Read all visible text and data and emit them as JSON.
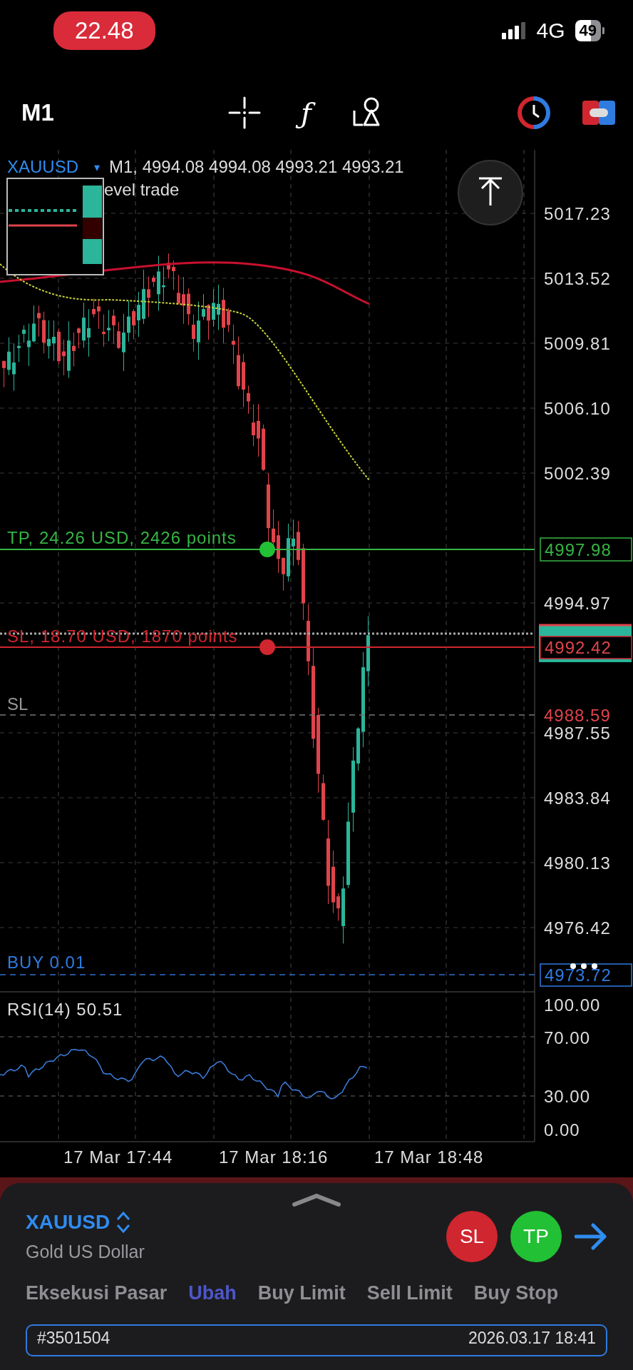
{
  "status_bar": {
    "time": "22.48",
    "network": "4G",
    "battery": "49"
  },
  "toolbar": {
    "timeframe": "M1",
    "function_symbol": "ƒ"
  },
  "chart": {
    "symbol": "XAUUSD",
    "symbol_caret": "▾",
    "quote": "M1, 4994.08 4994.08 4993.21 4993.21",
    "overlay_note": "evel trade",
    "price_axis": [
      "5017.23",
      "5013.52",
      "5009.81",
      "5006.10",
      "5002.39",
      "4994.97",
      "4987.55",
      "4983.84",
      "4980.13",
      "4976.42"
    ],
    "take_profit": {
      "label": "TP, 24.26 USD, 2426 points",
      "price": "4997.98"
    },
    "stop_loss": {
      "label": "SL, 18.70 USD, 1870 points",
      "price": "4992.42"
    },
    "sl_level": {
      "label": "SL",
      "price": "4988.59"
    },
    "position": {
      "label": "BUY 0.01",
      "price": "4973.72"
    },
    "rsi": {
      "label": "RSI(14) 50.51",
      "axis": [
        "100.00",
        "70.00",
        "30.00",
        "0.00"
      ]
    },
    "time_axis": [
      "17 Mar 17:44",
      "17 Mar 18:16",
      "17 Mar 18:48"
    ]
  },
  "order_panel": {
    "symbol": "XAUUSD",
    "description": "Gold US Dollar",
    "sl_button": "SL",
    "tp_button": "TP",
    "tabs": [
      {
        "label": "Eksekusi Pasar",
        "selected": false
      },
      {
        "label": "Ubah",
        "selected": true
      },
      {
        "label": "Buy Limit",
        "selected": false
      },
      {
        "label": "Sell Limit",
        "selected": false
      },
      {
        "label": "Buy Stop",
        "selected": false
      }
    ],
    "ticket": {
      "number": "#3501504",
      "time": "2026.03.17 18:41"
    }
  }
}
